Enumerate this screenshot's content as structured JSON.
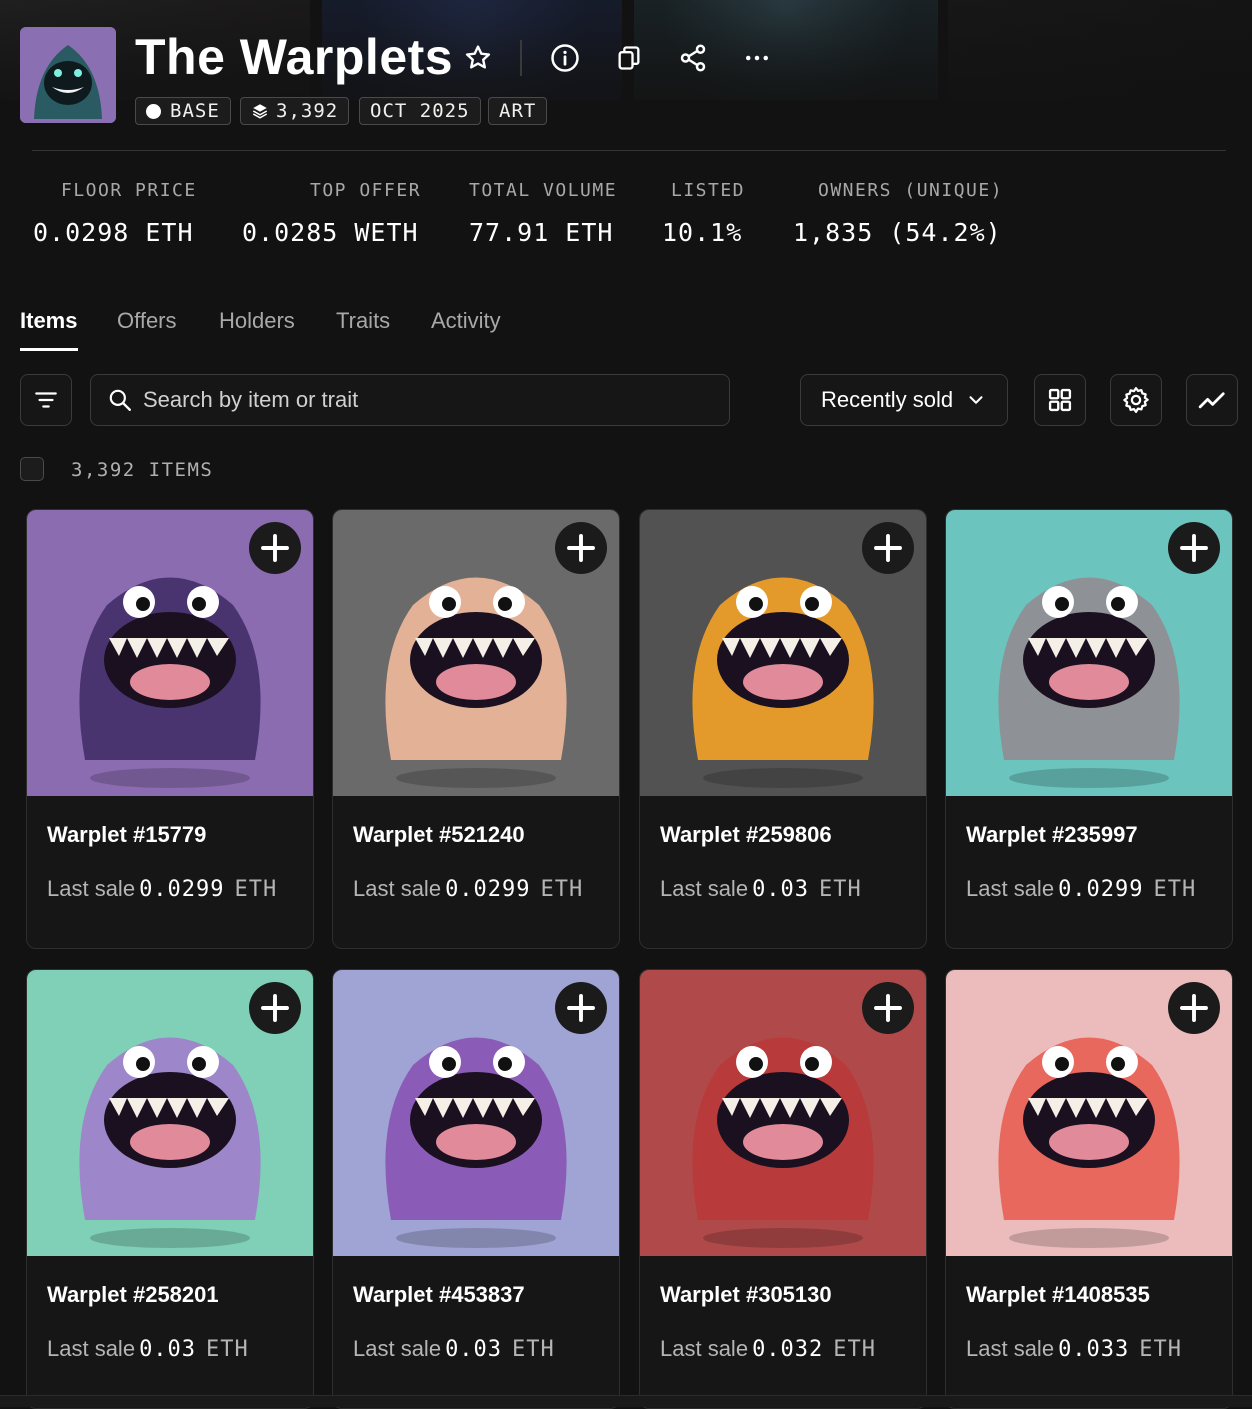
{
  "collection": {
    "title": "The Warplets",
    "tags": {
      "chain": "BASE",
      "supply": "3,392",
      "date": "OCT 2025",
      "category": "ART"
    }
  },
  "header_icons": [
    "star-icon",
    "info-icon",
    "copy-icon",
    "share-icon",
    "more-icon"
  ],
  "stats": {
    "floor_label": "FLOOR PRICE",
    "floor_value": "0.0298 ETH",
    "offer_label": "TOP OFFER",
    "offer_value": "0.0285 WETH",
    "volume_label": "TOTAL VOLUME",
    "volume_value": "77.91 ETH",
    "listed_label": "LISTED",
    "listed_value": "10.1%",
    "owners_label": "OWNERS (UNIQUE)",
    "owners_value": "1,835 (54.2%)"
  },
  "tabs": {
    "items": "Items",
    "offers": "Offers",
    "holders": "Holders",
    "traits": "Traits",
    "activity": "Activity"
  },
  "toolbar": {
    "search_placeholder": "Search by item or trait",
    "sort_value": "Recently sold"
  },
  "items_count": "3,392 ITEMS",
  "cards": [
    {
      "name": "Warplet #15779",
      "sale_label": "Last sale",
      "price": "0.0299",
      "currency": "ETH",
      "bg": "#8c6cb1",
      "body": "#4a3470"
    },
    {
      "name": "Warplet #521240",
      "sale_label": "Last sale",
      "price": "0.0299",
      "currency": "ETH",
      "bg": "#6a6a6a",
      "body": "#e3b196"
    },
    {
      "name": "Warplet #259806",
      "sale_label": "Last sale",
      "price": "0.03",
      "currency": "ETH",
      "bg": "#525252",
      "body": "#e39a2a"
    },
    {
      "name": "Warplet #235997",
      "sale_label": "Last sale",
      "price": "0.0299",
      "currency": "ETH",
      "bg": "#6cc4bf",
      "body": "#8e9296"
    },
    {
      "name": "Warplet #258201",
      "sale_label": "Last sale",
      "price": "0.03",
      "currency": "ETH",
      "bg": "#7fd0b6",
      "body": "#9d86c9"
    },
    {
      "name": "Warplet #453837",
      "sale_label": "Last sale",
      "price": "0.03",
      "currency": "ETH",
      "bg": "#9fa4d4",
      "body": "#8a5cb8"
    },
    {
      "name": "Warplet #305130",
      "sale_label": "Last sale",
      "price": "0.032",
      "currency": "ETH",
      "bg": "#b04a4a",
      "body": "#b83a3a"
    },
    {
      "name": "Warplet #1408535",
      "sale_label": "Last sale",
      "price": "0.033",
      "currency": "ETH",
      "bg": "#ecbcbc",
      "body": "#e8685e"
    }
  ]
}
